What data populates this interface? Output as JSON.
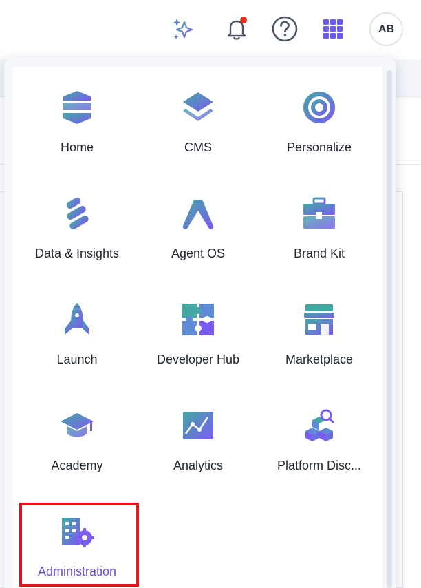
{
  "topbar": {
    "avatar_initials": "AB",
    "icons": [
      "sparkle-icon",
      "bell-icon",
      "help-icon",
      "apps-grid-icon"
    ],
    "notification_dot_color": "#e5301f",
    "icon_color": "#6b6fe0"
  },
  "apps": [
    {
      "label": "Home",
      "icon": "home-icon"
    },
    {
      "label": "CMS",
      "icon": "cms-icon"
    },
    {
      "label": "Personalize",
      "icon": "personalize-icon"
    },
    {
      "label": "Data & Insights",
      "icon": "data-insights-icon"
    },
    {
      "label": "Agent OS",
      "icon": "agent-os-icon"
    },
    {
      "label": "Brand Kit",
      "icon": "brand-kit-icon"
    },
    {
      "label": "Launch",
      "icon": "launch-icon"
    },
    {
      "label": "Developer Hub",
      "icon": "developer-hub-icon"
    },
    {
      "label": "Marketplace",
      "icon": "marketplace-icon"
    },
    {
      "label": "Academy",
      "icon": "academy-icon"
    },
    {
      "label": "Analytics",
      "icon": "analytics-icon"
    },
    {
      "label": "Platform Disc...",
      "icon": "platform-discovery-icon"
    },
    {
      "label": "Administration",
      "icon": "administration-icon",
      "highlighted": true
    }
  ],
  "colors": {
    "accent": "#6b4fd6",
    "highlight_border": "#e3141c",
    "icon_gradient_start": "#4aa8a8",
    "icon_gradient_end": "#7a5cf0"
  }
}
